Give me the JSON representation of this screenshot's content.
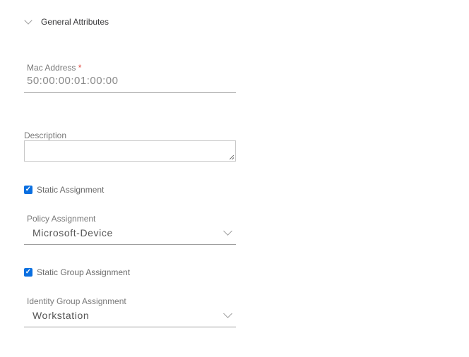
{
  "section": {
    "title": "General Attributes"
  },
  "mac": {
    "label": "Mac Address",
    "required": "*",
    "value": "50:00:00:01:00:00"
  },
  "description": {
    "label": "Description",
    "value": ""
  },
  "static_assignment": {
    "label": "Static Assignment",
    "checked": true
  },
  "policy": {
    "label": "Policy Assignment",
    "value": "Microsoft-Device"
  },
  "static_group": {
    "label": "Static Group Assignment",
    "checked": true
  },
  "identity_group": {
    "label": "Identity Group Assignment",
    "value": "Workstation"
  },
  "colors": {
    "accent": "#0a6fe0",
    "required": "#e0463c"
  }
}
